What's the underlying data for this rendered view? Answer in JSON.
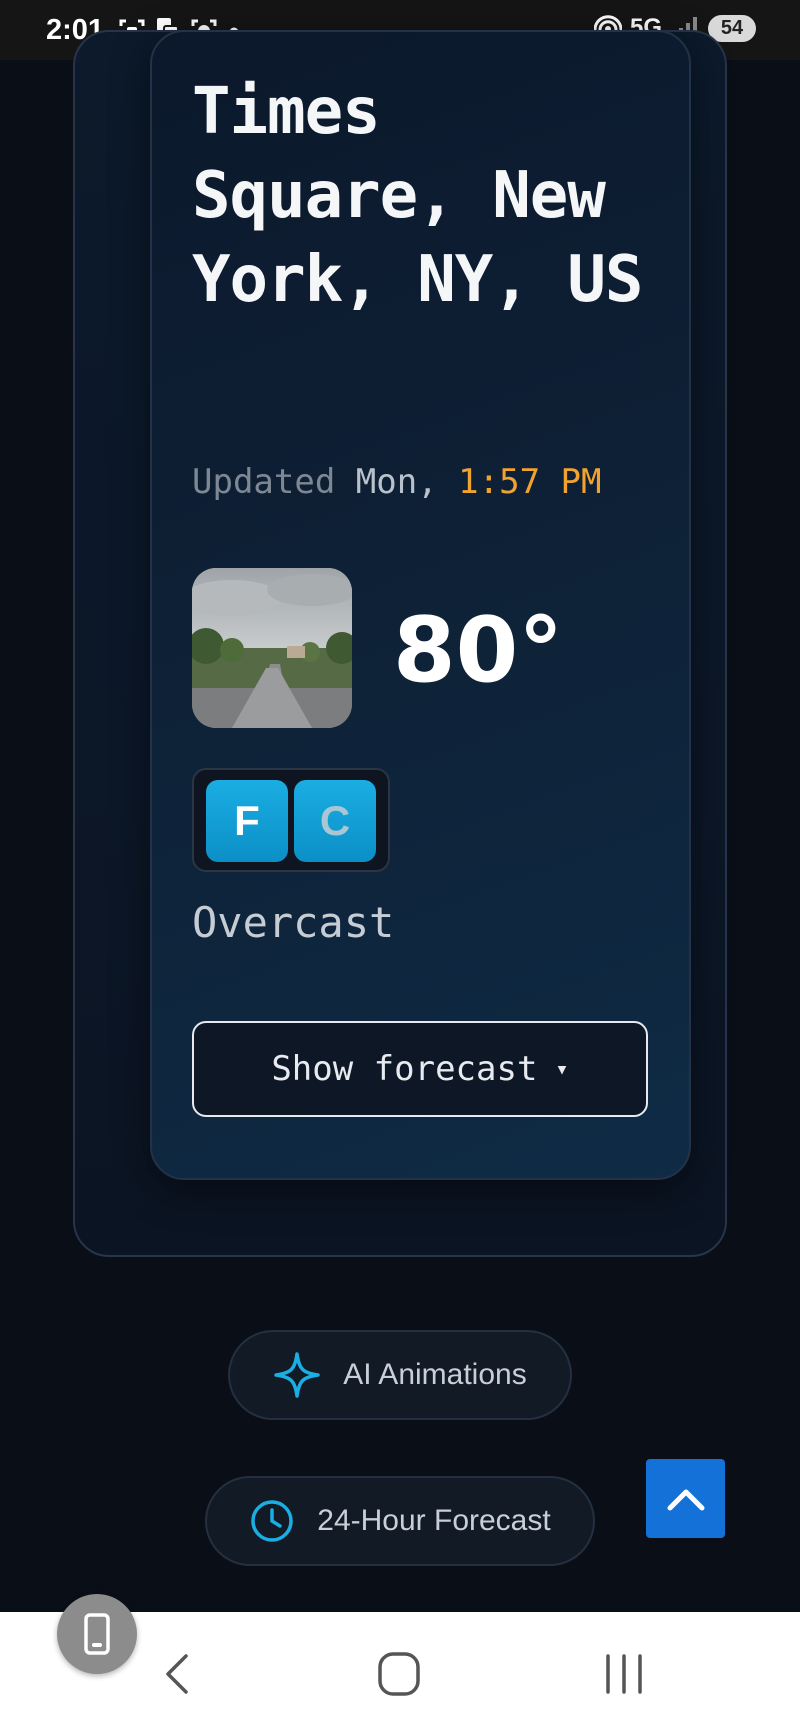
{
  "status_bar": {
    "time": "2:01",
    "network": "5G",
    "battery": "54",
    "icons": [
      "screenshot-icon",
      "copy-icon",
      "record-icon",
      "dot-icon",
      "hotspot-icon",
      "signal-icon"
    ]
  },
  "weather": {
    "location": "Times Square, New York, NY, US",
    "updated_label": "Updated",
    "updated_day": "Mon,",
    "updated_time": "1:57 PM",
    "temperature": "80°",
    "unit_f": "F",
    "unit_c": "C",
    "condition": "Overcast",
    "forecast_button": "Show forecast",
    "forecast_caret": "▾"
  },
  "actions": {
    "ai_animations": "AI Animations",
    "hour_forecast": "24-Hour Forecast"
  },
  "colors": {
    "accent": "#1aaee3",
    "time_highlight": "#f2a22e",
    "scroll_top": "#1471d8"
  }
}
